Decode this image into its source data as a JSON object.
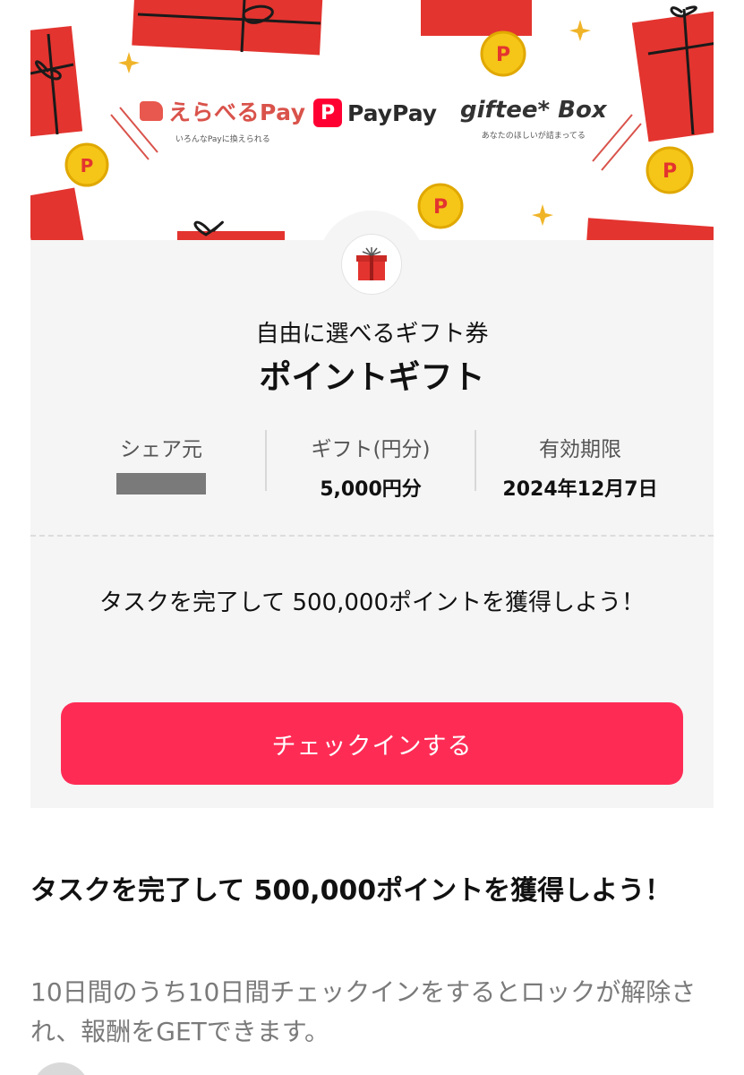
{
  "banner": {
    "logos": {
      "erabel": {
        "name": "えらべるPay",
        "tagline": "いろんなPayに換えられる",
        "color": "#d9534b"
      },
      "paypay": {
        "name": "PayPay",
        "mark": "P",
        "color": "#ff0033"
      },
      "giftee": {
        "name": "giftee* Box",
        "tagline": "あなたのほしいが詰まってる"
      }
    },
    "accent_red": "#e3342f",
    "coin_gold": "#f5c518"
  },
  "card": {
    "icon": "gift-box-icon",
    "subtitle": "自由に選べるギフト券",
    "title": "ポイントギフト",
    "info": {
      "sharer_label": "シェア元",
      "sharer_value_redacted": true,
      "gift_label": "ギフト(円分)",
      "gift_value": "5,000円分",
      "expiry_label": "有効期限",
      "expiry_value": "2024年12月7日"
    },
    "task_headline": "タスクを完了して 500,000ポイントを獲得しよう！",
    "checkin_button": "チェックインする",
    "button_color": "#fe2c55"
  },
  "task": {
    "title": "タスクを完了して 500,000ポイントを獲得しよう！",
    "description": "10日間のうち10日間チェックインをするとロックが解除され、報酬をGETできます。"
  }
}
